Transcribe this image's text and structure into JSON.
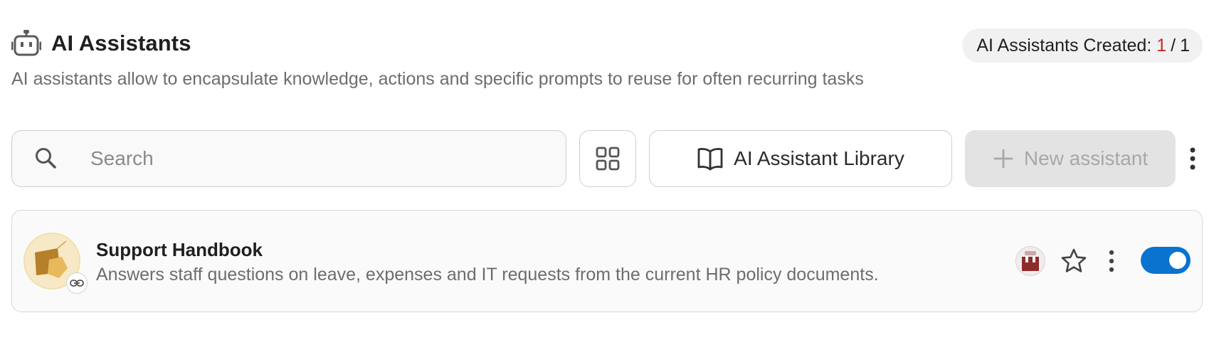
{
  "header": {
    "title": "AI Assistants",
    "icon": "robot-icon",
    "subtitle": "AI assistants allow to encapsulate knowledge, actions and specific prompts to reuse for often recurring tasks"
  },
  "quota": {
    "label": "AI Assistants Created:",
    "used": "1",
    "separator": "/",
    "limit": "1",
    "used_color": "#c62828"
  },
  "toolbar": {
    "search": {
      "placeholder": "Search",
      "value": "",
      "icon": "search-icon"
    },
    "grid_view_icon": "grid-view-icon",
    "library_label": "AI Assistant Library",
    "library_icon": "open-book-icon",
    "new_assistant_label": "New assistant",
    "new_assistant_disabled": true,
    "more_icon": "more-vertical-icon"
  },
  "assistants": [
    {
      "name": "Support Handbook",
      "description": "Answers staff questions on leave, expenses and IT requests from the current HR policy documents.",
      "avatar_icon": "assistant-avatar-icon",
      "shared_link_icon": "link-icon",
      "owner_icon": "owner-avatar",
      "favorite": false,
      "enabled": true
    }
  ],
  "colors": {
    "accent": "#0a73cf",
    "badge_bg": "#f1f1f1",
    "disabled_button_bg": "#e3e3e3"
  }
}
